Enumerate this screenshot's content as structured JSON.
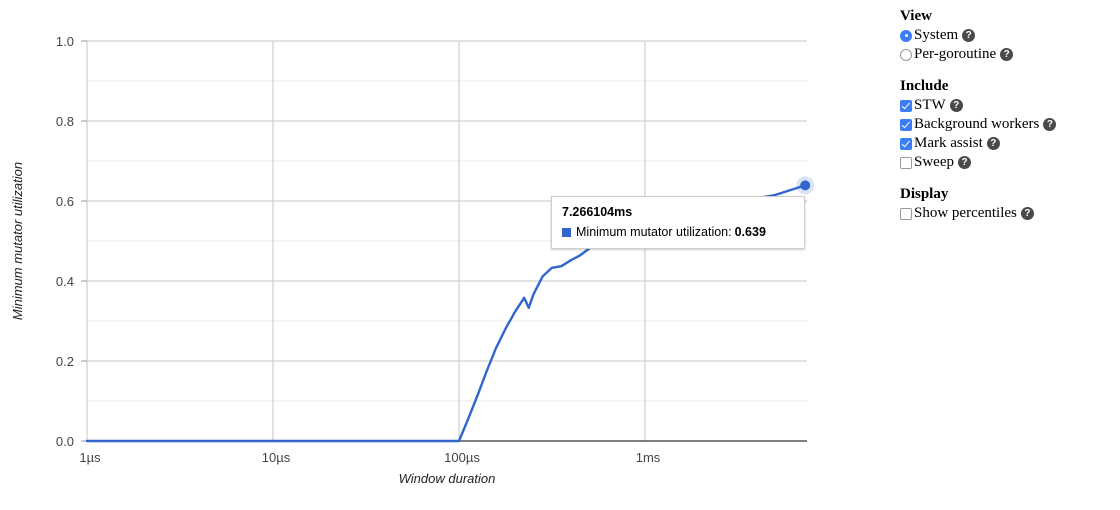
{
  "chart_data": {
    "type": "line",
    "title": "",
    "xlabel": "Window duration",
    "ylabel": "Minimum mutator utilization",
    "x_scale": "log",
    "x_tick_labels": [
      "1µs",
      "10µs",
      "100µs",
      "1ms"
    ],
    "x_tick_values": [
      1e-06,
      1e-05,
      0.0001,
      0.001
    ],
    "xlim": [
      1e-06,
      0.0076
    ],
    "y_tick_labels": [
      "0.0",
      "0.2",
      "0.4",
      "0.6",
      "0.8",
      "1.0"
    ],
    "y_tick_values": [
      0.0,
      0.2,
      0.4,
      0.6,
      0.8,
      1.0
    ],
    "ylim": [
      0,
      1
    ],
    "grid": true,
    "legend_position": "none",
    "series": [
      {
        "name": "Minimum mutator utilization",
        "color": "#3366cc",
        "points": [
          [
            1e-06,
            0.0
          ],
          [
            1e-05,
            0.0
          ],
          [
            5e-05,
            0.0
          ],
          [
            9e-05,
            0.0
          ],
          [
            0.0001,
            0.0
          ],
          [
            0.000112,
            0.055
          ],
          [
            0.000126,
            0.115
          ],
          [
            0.000141,
            0.175
          ],
          [
            0.000158,
            0.232
          ],
          [
            0.000178,
            0.281
          ],
          [
            0.0002,
            0.323
          ],
          [
            0.000224,
            0.358
          ],
          [
            0.000237,
            0.333
          ],
          [
            0.000251,
            0.366
          ],
          [
            0.000282,
            0.412
          ],
          [
            0.000316,
            0.433
          ],
          [
            0.000355,
            0.437
          ],
          [
            0.0004,
            0.452
          ],
          [
            0.000447,
            0.464
          ],
          [
            0.000501,
            0.481
          ],
          [
            0.000562,
            0.505
          ],
          [
            0.0007,
            0.545
          ],
          [
            0.005,
            0.615
          ],
          [
            0.007266104,
            0.639
          ]
        ]
      }
    ],
    "highlighted_point": {
      "x_label": "7.266104ms",
      "series_name": "Minimum mutator utilization",
      "value": "0.639",
      "color": "#3366cc"
    }
  },
  "tooltip": {
    "title": "7.266104ms",
    "series_label": "Minimum mutator utilization:",
    "value": "0.639",
    "swatch_color": "#3366cc"
  },
  "controls": {
    "view": {
      "heading": "View",
      "options": [
        {
          "label": "System",
          "checked": true,
          "help": "?"
        },
        {
          "label": "Per-goroutine",
          "checked": false,
          "help": "?"
        }
      ]
    },
    "include": {
      "heading": "Include",
      "options": [
        {
          "label": "STW",
          "checked": true,
          "help": "?"
        },
        {
          "label": "Background workers",
          "checked": true,
          "help": "?"
        },
        {
          "label": "Mark assist",
          "checked": true,
          "help": "?"
        },
        {
          "label": "Sweep",
          "checked": false,
          "help": "?"
        }
      ]
    },
    "display": {
      "heading": "Display",
      "options": [
        {
          "label": "Show percentiles",
          "checked": false,
          "help": "?"
        }
      ]
    }
  },
  "colors": {
    "line": "#3366cc",
    "accent": "#3b7df5",
    "grid_major": "#bdbdbd",
    "grid_minor": "#e6e6e6",
    "axis": "#333333"
  }
}
